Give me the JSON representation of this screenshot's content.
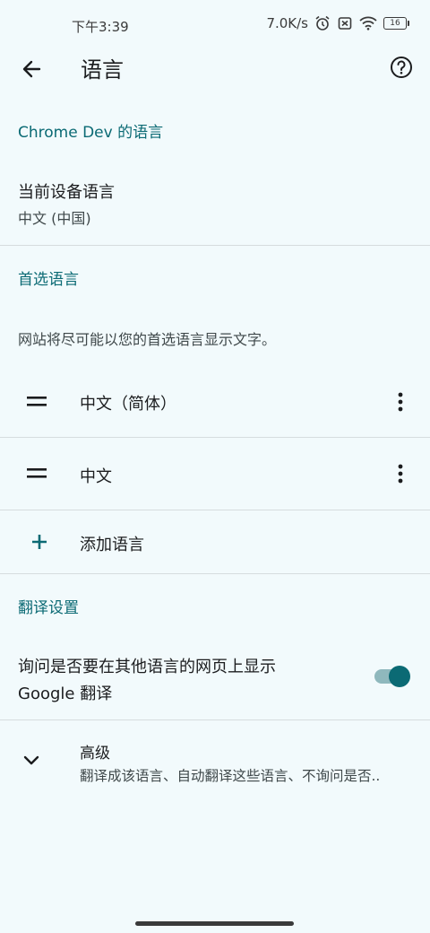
{
  "status_bar": {
    "time": "下午3:39",
    "network_speed": "7.0K/s",
    "battery": "16",
    "icons": [
      "alarm-icon",
      "sim-off-icon",
      "wifi-icon",
      "battery-icon"
    ]
  },
  "app_bar": {
    "title": "语言",
    "back_icon": "arrow-back-icon",
    "help_icon": "help-circle-icon"
  },
  "app_language": {
    "header": "Chrome Dev 的语言",
    "device_language_title": "当前设备语言",
    "device_language_value": "中文 (中国)"
  },
  "preferred": {
    "header": "首选语言",
    "description": "网站将尽可能以您的首选语言显示文字。",
    "languages": [
      {
        "label": "中文（简体）"
      },
      {
        "label": "中文"
      }
    ],
    "add_label": "添加语言"
  },
  "translate": {
    "header": "翻译设置",
    "offer_label_line1": "询问是否要在其他语言的网页上显示",
    "offer_label_line2": "Google 翻译",
    "offer_enabled": true
  },
  "advanced": {
    "title": "高级",
    "summary": "翻译成该语言、自动翻译这些语言、不询问是否.."
  },
  "colors": {
    "accent": "#0b6a74",
    "background": "#f2fafc",
    "divider": "#d6dcde"
  }
}
